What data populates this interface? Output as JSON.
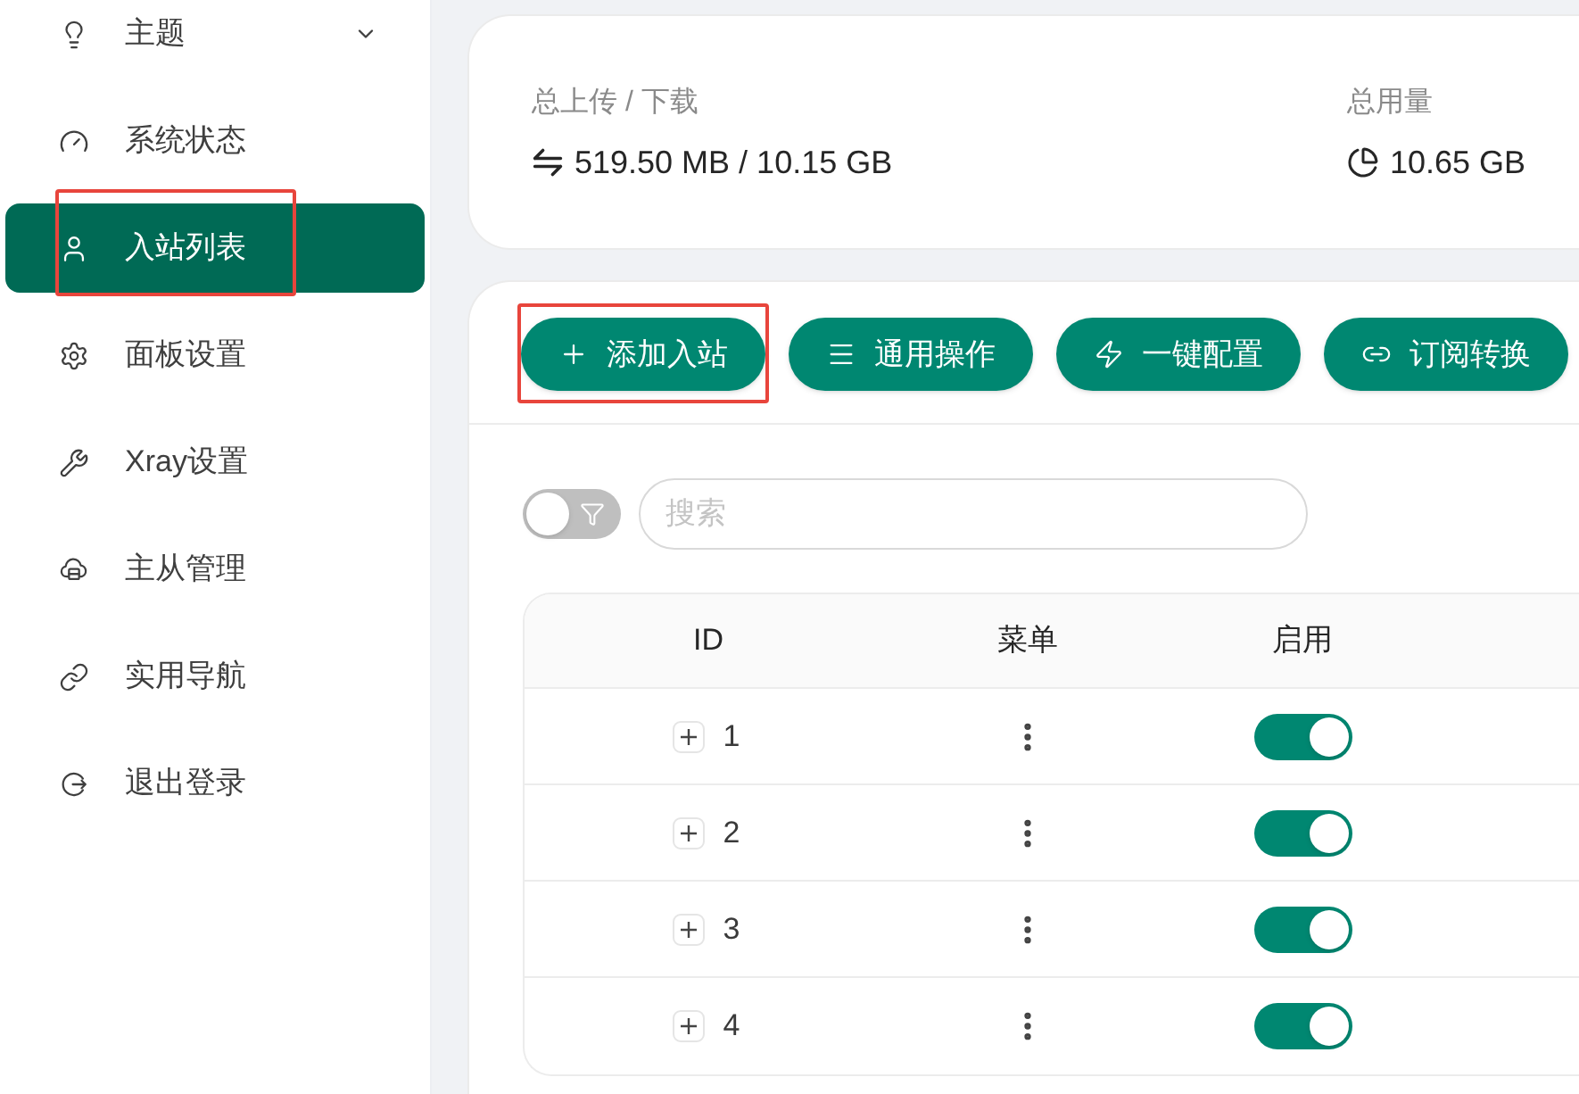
{
  "sidebar": {
    "items": [
      {
        "label": "主题",
        "kind": "submenu",
        "expanded": false,
        "selected": false,
        "annotated": false
      },
      {
        "label": "系统状态",
        "kind": "link",
        "selected": false,
        "annotated": false
      },
      {
        "label": "入站列表",
        "kind": "link",
        "selected": true,
        "annotated": true
      },
      {
        "label": "面板设置",
        "kind": "link",
        "selected": false,
        "annotated": false
      },
      {
        "label": "Xray设置",
        "kind": "link",
        "selected": false,
        "annotated": false
      },
      {
        "label": "主从管理",
        "kind": "link",
        "selected": false,
        "annotated": false
      },
      {
        "label": "实用导航",
        "kind": "link",
        "selected": false,
        "annotated": false
      },
      {
        "label": "退出登录",
        "kind": "link",
        "selected": false,
        "annotated": false
      }
    ]
  },
  "stats": [
    {
      "label": "总上传 / 下载",
      "value": "519.50 MB / 10.15 GB"
    },
    {
      "label": "总用量",
      "value": "10.65 GB"
    }
  ],
  "toolbar": {
    "buttons": [
      {
        "label": "添加入站",
        "annotated": true
      },
      {
        "label": "通用操作",
        "annotated": false
      },
      {
        "label": "一键配置",
        "annotated": false
      },
      {
        "label": "订阅转换",
        "annotated": false
      }
    ]
  },
  "filter_toggle": {
    "on": false
  },
  "search": {
    "placeholder": "搜索"
  },
  "table": {
    "columns": [
      "ID",
      "菜单",
      "启用"
    ],
    "rows": [
      {
        "id": "1",
        "enabled": true
      },
      {
        "id": "2",
        "enabled": true
      },
      {
        "id": "3",
        "enabled": true
      },
      {
        "id": "4",
        "enabled": true
      }
    ]
  }
}
